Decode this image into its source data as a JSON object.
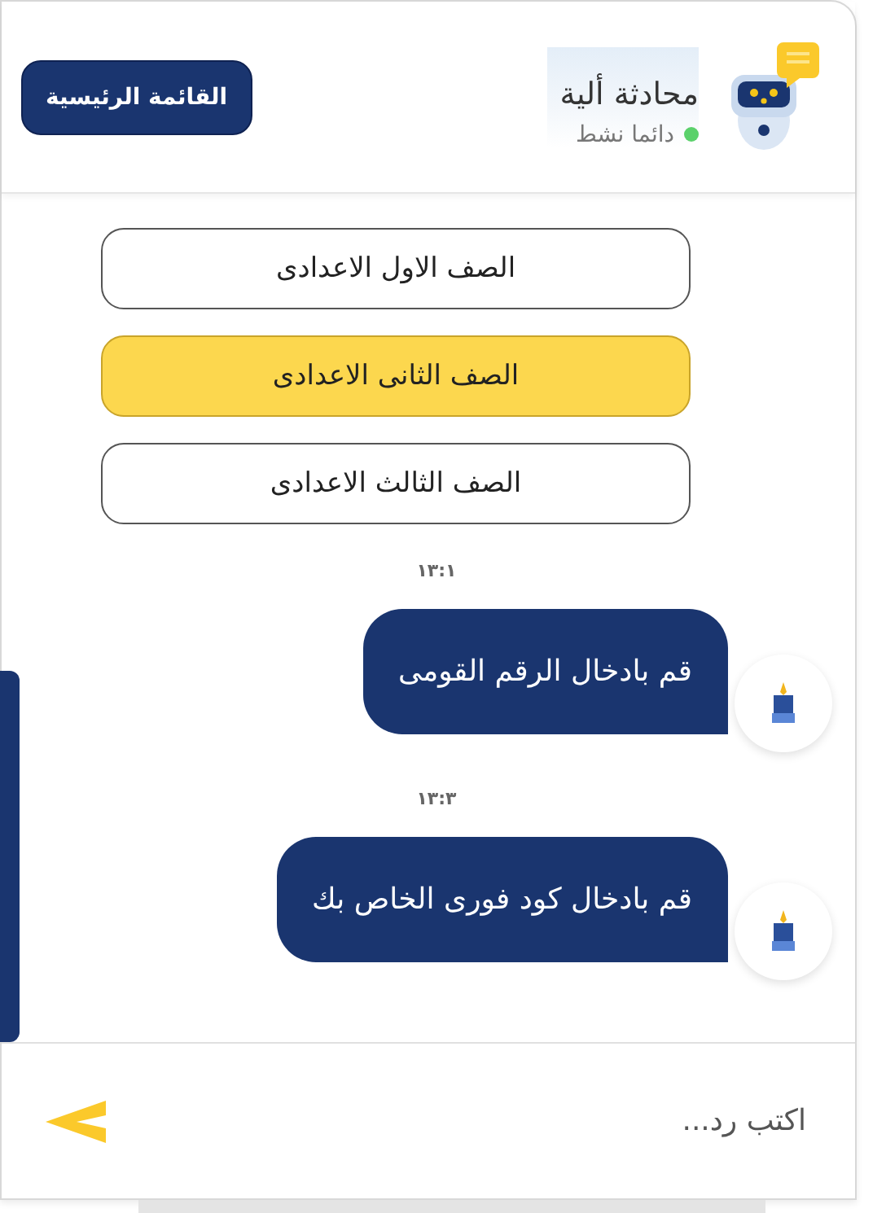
{
  "header": {
    "title": "محادثة ألية",
    "status": "دائما نشط",
    "online": true,
    "menu_button": "القائمة الرئيسية"
  },
  "options": [
    {
      "label": "الصف الاول الاعدادى",
      "selected": false
    },
    {
      "label": "الصف الثانى الاعدادى",
      "selected": true
    },
    {
      "label": "الصف الثالث الاعدادى",
      "selected": false
    }
  ],
  "messages": [
    {
      "time": "١٣:١",
      "text": "قم بادخال الرقم القومى"
    },
    {
      "time": "١٣:٣",
      "text": "قم بادخال كود فورى الخاص بك"
    }
  ],
  "composer": {
    "placeholder": "اكتب رد..."
  }
}
